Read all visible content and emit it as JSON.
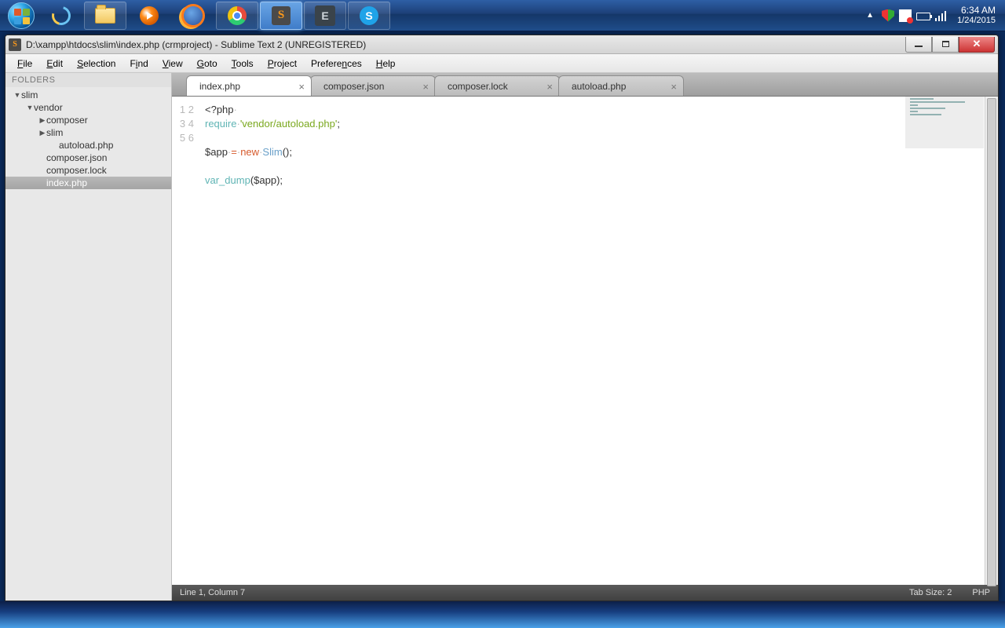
{
  "taskbar": {
    "buttons": [
      "start",
      "ie",
      "explorer",
      "wmp",
      "firefox",
      "chrome",
      "sublime",
      "evernote",
      "skype"
    ],
    "clock_time": "6:34 AM",
    "clock_date": "1/24/2015"
  },
  "window": {
    "title": "D:\\xampp\\htdocs\\slim\\index.php (crmproject) - Sublime Text 2 (UNREGISTERED)"
  },
  "menu": {
    "file": "File",
    "edit": "Edit",
    "selection": "Selection",
    "find": "Find",
    "view": "View",
    "goto": "Goto",
    "tools": "Tools",
    "project": "Project",
    "preferences": "Preferences",
    "help": "Help"
  },
  "sidebar": {
    "header": "FOLDERS",
    "tree": [
      {
        "label": "slim",
        "class": "ind1",
        "tw": "▼"
      },
      {
        "label": "vendor",
        "class": "ind2",
        "tw": "▼"
      },
      {
        "label": "composer",
        "class": "ind3",
        "tw": "▶"
      },
      {
        "label": "slim",
        "class": "ind3",
        "tw": "▶"
      },
      {
        "label": "autoload.php",
        "class": "ind4",
        "tw": ""
      },
      {
        "label": "composer.json",
        "class": "ind3",
        "tw": ""
      },
      {
        "label": "composer.lock",
        "class": "ind3",
        "tw": ""
      },
      {
        "label": "index.php",
        "class": "ind3 sel",
        "tw": ""
      }
    ]
  },
  "tabs": [
    {
      "label": "index.php",
      "active": true
    },
    {
      "label": "composer.json",
      "active": false
    },
    {
      "label": "composer.lock",
      "active": false
    },
    {
      "label": "autoload.php",
      "active": false
    }
  ],
  "code": {
    "lines": [
      "1",
      "2",
      "3",
      "4",
      "5",
      "6"
    ],
    "l1_open": "<?php",
    "l2_req": "require",
    "l2_sp": " ",
    "l2_str": "'vendor/autoload.php'",
    "l2_semi": ";",
    "l4_var": "$app",
    "l4_sp1": " ",
    "l4_eq": "=",
    "l4_sp2": " ",
    "l4_new": "new",
    "l4_sp3": " ",
    "l4_cls": "Slim",
    "l4_tail": "();",
    "l6_fn": "var_dump",
    "l6_open": "(",
    "l6_var": "$app",
    "l6_close": ");"
  },
  "status": {
    "left": "Line 1, Column 7",
    "tab": "Tab Size: 2",
    "lang": "PHP"
  },
  "desk": {
    "a": "‎",
    "b": "‎",
    "c": "‎"
  }
}
